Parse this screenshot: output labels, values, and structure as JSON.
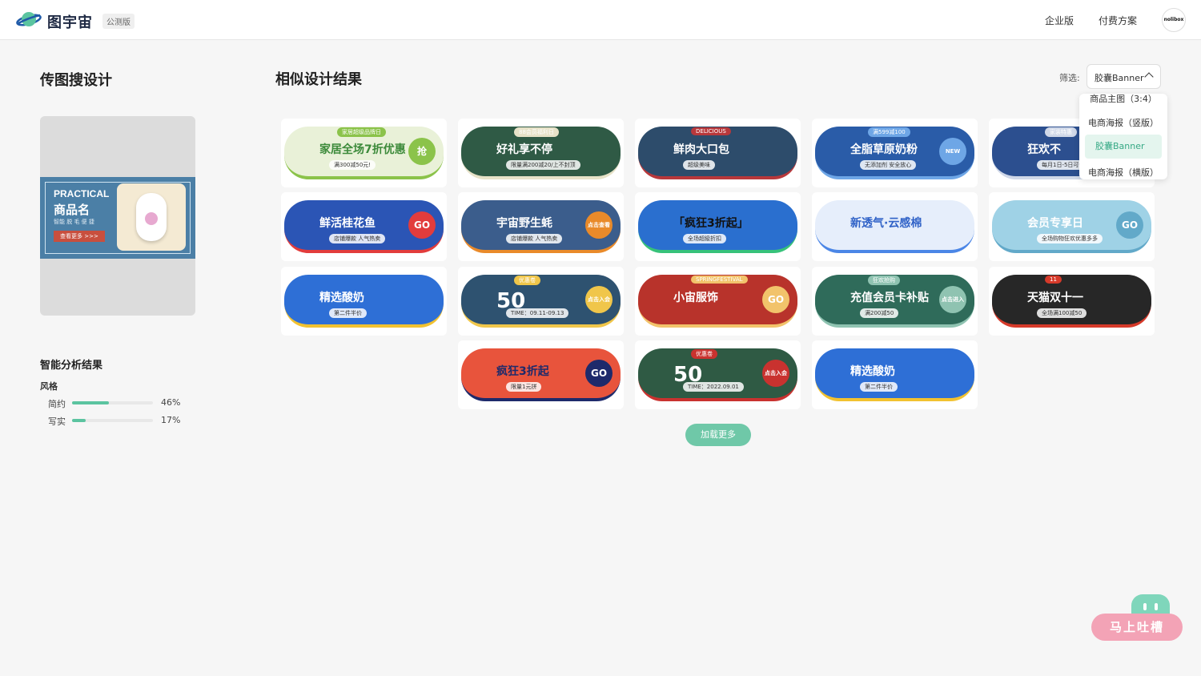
{
  "header": {
    "brand": "图宇宙",
    "beta_badge": "公测版",
    "nav": [
      "企业版",
      "付费方案"
    ],
    "avatar_text": "nolibox"
  },
  "left_panel": {
    "title": "传图搜设计",
    "uploaded_banner": {
      "line1": "PRACTICAL",
      "line2": "商品名",
      "line3": "智能 脱 毛 便 捷",
      "button": "查看更多 >>>"
    },
    "analysis_title": "智能分析结果",
    "style_label": "风格",
    "styles": [
      {
        "label": "简约",
        "percent_text": "46%",
        "value": 0.46
      },
      {
        "label": "写实",
        "percent_text": "17%",
        "value": 0.17
      }
    ]
  },
  "main": {
    "title": "相似设计结果",
    "filter_label": "筛选:",
    "filter_value": "胶囊Banner",
    "dropdown_options": [
      "商品主图（3:4）",
      "电商海报（竖版）",
      "胶囊Banner",
      "电商海报（横版）"
    ],
    "selected_option": "胶囊Banner",
    "load_more": "加载更多"
  },
  "cards": [
    {
      "title": "家居全场7折优惠",
      "tag": "家居超级品牌日",
      "sub": "满300减50元!",
      "badge": "抢",
      "bg": "#e9f1d8",
      "fg": "#3c8a3a",
      "accent": "#8bc34a"
    },
    {
      "title": "好礼享不停",
      "tag": "88会员福利日",
      "sub": "限量满200减20/上不封顶",
      "badge": "",
      "bg": "#2f5a45",
      "fg": "#ffffff",
      "accent": "#e7e2c8"
    },
    {
      "title": "鲜肉大口包",
      "tag": "DELICIOUS",
      "sub": "超级美味",
      "badge": "",
      "bg": "#2d4c6b",
      "fg": "#ffffff",
      "accent": "#b8383b"
    },
    {
      "title": "全脂草原奶粉",
      "tag": "满599减100",
      "sub": "无添加剂 安全放心",
      "badge": "NEW",
      "bg": "#2a5ca8",
      "fg": "#ffffff",
      "accent": "#6ea6e6"
    },
    {
      "title": "狂欢不",
      "tag": "家装特惠",
      "sub": "每月1日-5日可使用",
      "badge": "",
      "bg": "#2c4f8f",
      "fg": "#ffffff",
      "accent": "#d0d8e8"
    },
    {
      "title": "鲜活桂花鱼",
      "tag": "",
      "sub": "店铺爆款 人气热卖",
      "badge": "GO",
      "bg": "#2b55b5",
      "fg": "#ffffff",
      "accent": "#e23c3c"
    },
    {
      "title": "宇宙野生蚝",
      "tag": "",
      "sub": "店铺爆款 人气热卖",
      "badge": "点击查看",
      "bg": "#3b5d8c",
      "fg": "#ffffff",
      "accent": "#e98a2a"
    },
    {
      "title": "「疯狂3折起」",
      "tag": "",
      "sub": "全场超級折扣",
      "badge": "",
      "bg": "#2a6fcf",
      "fg": "#111111",
      "accent": "#37c27a"
    },
    {
      "title": "新透气·云感棉",
      "tag": "",
      "sub": "",
      "badge": "",
      "bg": "#e6eefb",
      "fg": "#3062c7",
      "accent": "#4b86e6"
    },
    {
      "title": "会员专享日",
      "tag": "",
      "sub": "全场购物狂欢优惠多多",
      "badge": "GO",
      "bg": "#9fd2e6",
      "fg": "#ffffff",
      "accent": "#62a9c9"
    },
    {
      "title": "精选酸奶",
      "tag": "",
      "sub": "第二件半价",
      "badge": "",
      "bg": "#2e6fd6",
      "fg": "#ffffff",
      "accent": "#f2c230"
    },
    {
      "title": "50",
      "tag": "优惠卷",
      "sub": "TIME：09.11-09.13",
      "badge": "点击入会",
      "bg": "#2e5270",
      "fg": "#ffffff",
      "accent": "#f0c64a"
    },
    {
      "title": "小宙服饰",
      "tag": "SPRINGFESTIVAL",
      "sub": "",
      "badge": "GO",
      "bg": "#b8332b",
      "fg": "#ffffff",
      "accent": "#f2c36b"
    },
    {
      "title": "充值会员卡补贴",
      "tag": "狂欢抢购",
      "sub": "满200减50",
      "badge": "点击进入",
      "bg": "#2f6b5a",
      "fg": "#ffffff",
      "accent": "#8fc3b1"
    },
    {
      "title": "天猫双十一",
      "tag": "11",
      "sub": "全场满100减50",
      "badge": "",
      "bg": "#272727",
      "fg": "#ffffff",
      "accent": "#d63a2a"
    },
    {
      "title": "疯狂3折起",
      "tag": "",
      "sub": "限量1元拼",
      "badge": "GO",
      "bg": "#e8543c",
      "fg": "#1e2a6b",
      "accent": "#1e2a6b"
    },
    {
      "title": "50",
      "tag": "优惠卷",
      "sub": "TIME：2022.09.01",
      "badge": "点击入会",
      "bg": "#2f5a44",
      "fg": "#ffffff",
      "accent": "#c9322f"
    },
    {
      "title": "精选酸奶",
      "tag": "",
      "sub": "第二件半价",
      "badge": "",
      "bg": "#2e6fd6",
      "fg": "#ffffff",
      "accent": "#f2c230"
    }
  ],
  "feedback": {
    "label": "马上吐槽"
  }
}
